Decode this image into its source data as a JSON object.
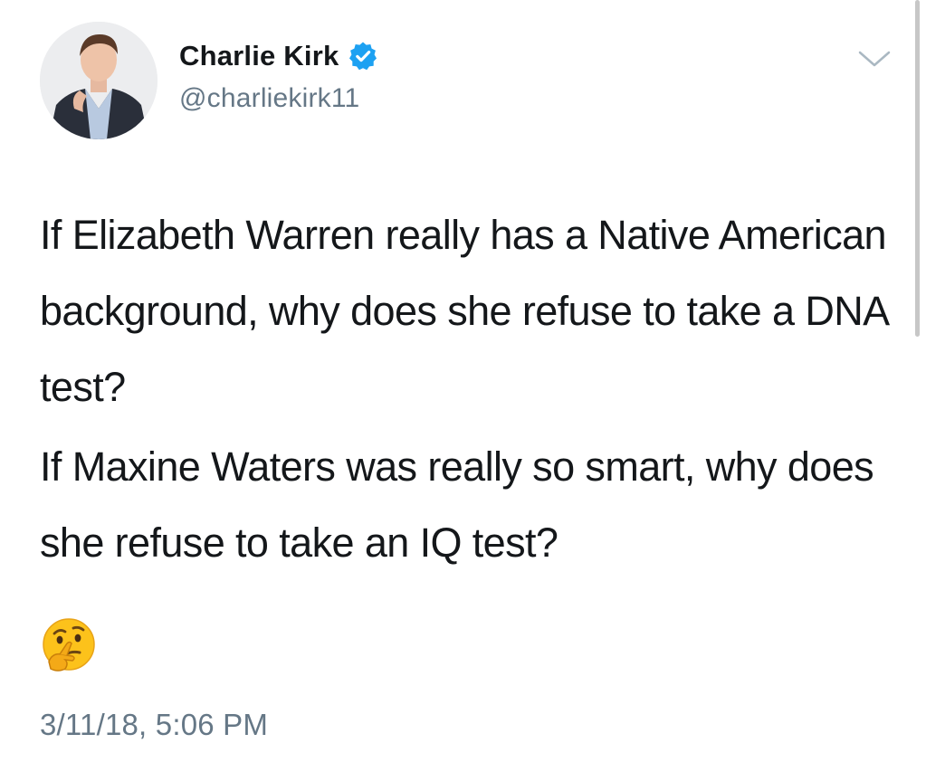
{
  "user": {
    "display_name": "Charlie Kirk",
    "handle": "@charliekirk11",
    "verified": true
  },
  "tweet": {
    "paragraphs": [
      "If Elizabeth Warren really has a Native American background, why does she refuse to take a DNA test?",
      "If Maxine Waters was really so smart, why does she refuse to take an IQ test?"
    ],
    "emoji": "thinking-face-icon",
    "timestamp": "3/11/18, 5:06 PM"
  },
  "colors": {
    "text": "#14171a",
    "secondary": "#657786",
    "verified_blue": "#1da1f2",
    "background": "#ffffff"
  }
}
